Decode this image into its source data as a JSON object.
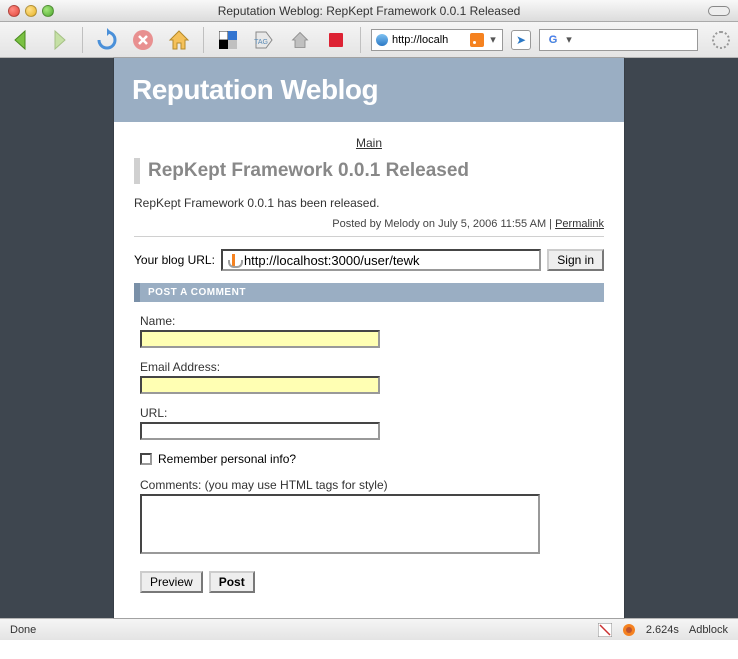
{
  "window": {
    "title": "Reputation Weblog: RepKept Framework 0.0.1 Released"
  },
  "toolbar": {
    "url": "http://localh",
    "search_placeholder": ""
  },
  "page": {
    "banner_title": "Reputation Weblog",
    "main_link": "Main",
    "post_title": "RepKept Framework 0.0.1 Released",
    "post_body": "RepKept Framework 0.0.1 has been released.",
    "meta_prefix": "Posted by Melody on July 5, 2006 11:55 AM | ",
    "permalink": "Permalink"
  },
  "blog_url": {
    "label": "Your blog URL:",
    "value": "http://localhost:3000/user/tewk",
    "signin": "Sign in"
  },
  "comment_section": {
    "header": "POST A COMMENT",
    "name_label": "Name:",
    "email_label": "Email Address:",
    "url_label": "URL:",
    "remember_label": "Remember personal info?",
    "comments_label": "Comments: (you may use HTML tags for style)",
    "preview": "Preview",
    "post": "Post"
  },
  "statusbar": {
    "left": "Done",
    "time": "2.624s",
    "adblock": "Adblock"
  }
}
